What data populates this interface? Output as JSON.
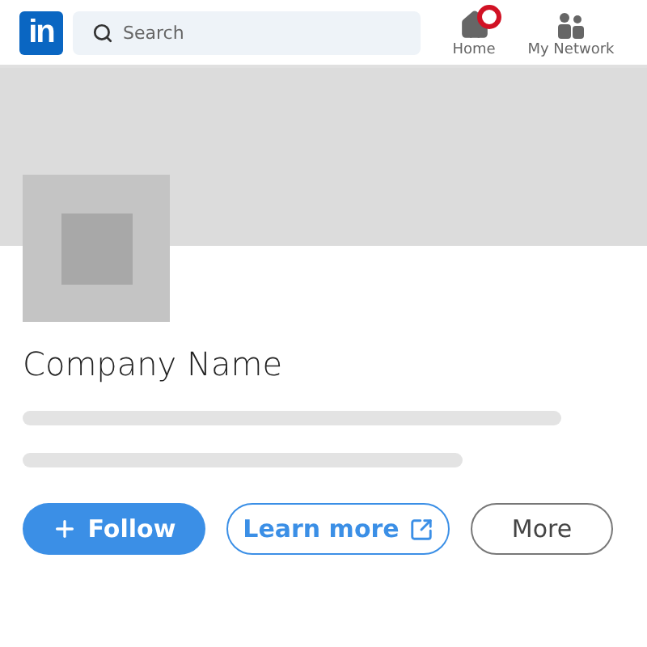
{
  "header": {
    "logo": "in",
    "search": {
      "placeholder": "Search"
    },
    "nav": [
      {
        "label": "Home",
        "kind": "home",
        "badge": true
      },
      {
        "label": "My Network",
        "kind": "network",
        "badge": false
      }
    ]
  },
  "company": {
    "name": "Company Name"
  },
  "buttons": [
    {
      "label": "Follow",
      "kind": "primary"
    },
    {
      "label": "Learn more",
      "kind": "outline"
    },
    {
      "label": "More",
      "kind": "plain"
    }
  ]
}
